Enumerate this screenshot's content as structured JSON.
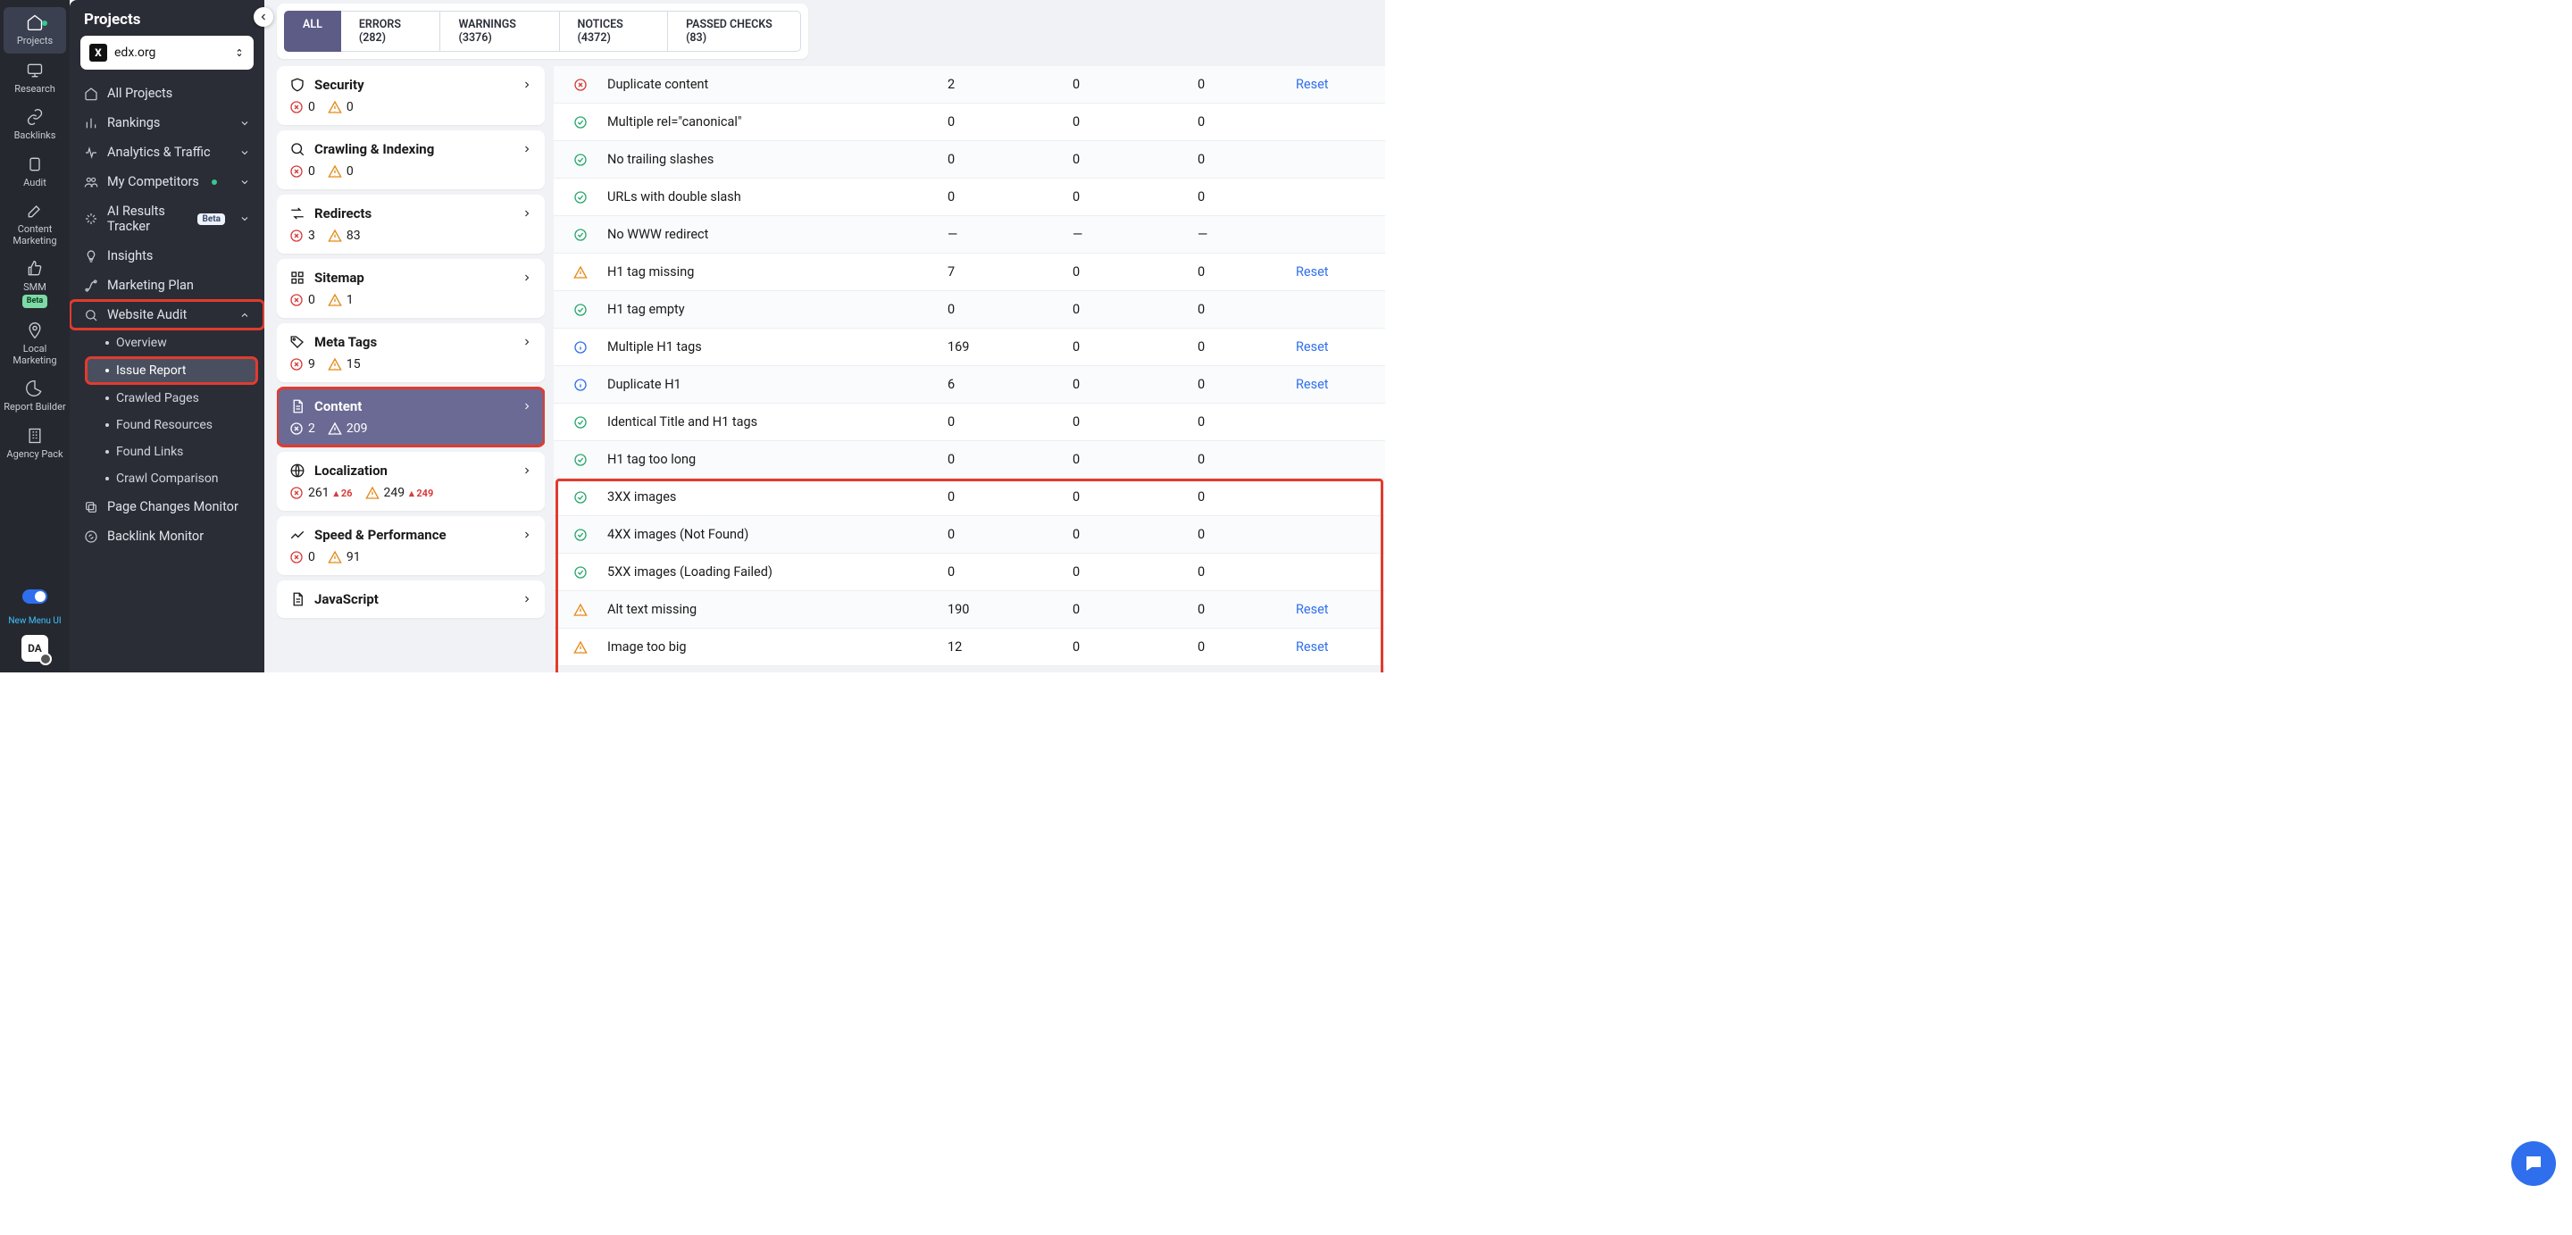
{
  "rail": {
    "items": [
      {
        "label": "Projects",
        "icon": "home"
      },
      {
        "label": "Research",
        "icon": "monitor"
      },
      {
        "label": "Backlinks",
        "icon": "link"
      },
      {
        "label": "Audit",
        "icon": "clipboard"
      },
      {
        "label": "Content Marketing",
        "icon": "edit"
      },
      {
        "label": "SMM",
        "icon": "thumbsup"
      },
      {
        "label": "Local Marketing",
        "icon": "pin"
      },
      {
        "label": "Report Builder",
        "icon": "pie"
      },
      {
        "label": "Agency Pack",
        "icon": "building"
      }
    ],
    "beta_label": "Beta",
    "new_menu": "New Menu UI",
    "da": "DA"
  },
  "sidebar": {
    "title": "Projects",
    "project": "edx.org",
    "items": [
      {
        "label": "All Projects",
        "icon": "home",
        "chev": false
      },
      {
        "label": "Rankings",
        "icon": "bars",
        "chev": true
      },
      {
        "label": "Analytics & Traffic",
        "icon": "pulse",
        "chev": true
      },
      {
        "label": "My Competitors",
        "icon": "users",
        "chev": true,
        "dot": true
      },
      {
        "label": "AI Results Tracker",
        "icon": "sparkle",
        "chev": true,
        "beta": true
      },
      {
        "label": "Insights",
        "icon": "bulb",
        "chev": false
      },
      {
        "label": "Marketing Plan",
        "icon": "route",
        "chev": false
      },
      {
        "label": "Website Audit",
        "icon": "search",
        "chev": true,
        "expanded": true
      },
      {
        "label": "Page Changes Monitor",
        "icon": "copy",
        "chev": false
      },
      {
        "label": "Backlink Monitor",
        "icon": "linkcircle",
        "chev": false
      }
    ],
    "audit_sub": [
      {
        "label": "Overview"
      },
      {
        "label": "Issue Report",
        "active": true
      },
      {
        "label": "Crawled Pages"
      },
      {
        "label": "Found Resources"
      },
      {
        "label": "Found Links"
      },
      {
        "label": "Crawl Comparison"
      }
    ],
    "beta_pill": "Beta"
  },
  "tabs": [
    {
      "label": "ALL",
      "active": true
    },
    {
      "label": "ERRORS (282)"
    },
    {
      "label": "WARNINGS (3376)"
    },
    {
      "label": "NOTICES (4372)"
    },
    {
      "label": "PASSED CHECKS (83)"
    }
  ],
  "categories": [
    {
      "name": "Security",
      "icon": "shield",
      "err": "0",
      "warn": "0"
    },
    {
      "name": "Crawling & Indexing",
      "icon": "search",
      "err": "0",
      "warn": "0"
    },
    {
      "name": "Redirects",
      "icon": "redirect",
      "err": "3",
      "warn": "83"
    },
    {
      "name": "Sitemap",
      "icon": "grid",
      "err": "0",
      "warn": "1"
    },
    {
      "name": "Meta Tags",
      "icon": "tag",
      "err": "9",
      "warn": "15"
    },
    {
      "name": "Content",
      "icon": "doc",
      "err": "2",
      "warn": "209",
      "active": true
    },
    {
      "name": "Localization",
      "icon": "globe",
      "err": "261",
      "warn": "249",
      "errDelta": "26",
      "warnDelta": "249"
    },
    {
      "name": "Speed & Performance",
      "icon": "trend",
      "err": "0",
      "warn": "91"
    },
    {
      "name": "JavaScript",
      "icon": "js",
      "partial": true
    }
  ],
  "issues": [
    {
      "icon": "err",
      "name": "Duplicate content",
      "a": "2",
      "b": "0",
      "c": "0",
      "reset": true
    },
    {
      "icon": "pass",
      "name": "Multiple rel=\"canonical\"",
      "a": "0",
      "b": "0",
      "c": "0"
    },
    {
      "icon": "pass",
      "name": "No trailing slashes",
      "a": "0",
      "b": "0",
      "c": "0"
    },
    {
      "icon": "pass",
      "name": "URLs with double slash",
      "a": "0",
      "b": "0",
      "c": "0"
    },
    {
      "icon": "pass",
      "name": "No WWW redirect",
      "a": "—",
      "b": "—",
      "c": "—"
    },
    {
      "icon": "warn",
      "name": "H1 tag missing",
      "a": "7",
      "b": "0",
      "c": "0",
      "reset": true
    },
    {
      "icon": "pass",
      "name": "H1 tag empty",
      "a": "0",
      "b": "0",
      "c": "0"
    },
    {
      "icon": "info",
      "name": "Multiple H1 tags",
      "a": "169",
      "b": "0",
      "c": "0",
      "reset": true
    },
    {
      "icon": "info",
      "name": "Duplicate H1",
      "a": "6",
      "b": "0",
      "c": "0",
      "reset": true
    },
    {
      "icon": "pass",
      "name": "Identical Title and H1 tags",
      "a": "0",
      "b": "0",
      "c": "0"
    },
    {
      "icon": "pass",
      "name": "H1 tag too long",
      "a": "0",
      "b": "0",
      "c": "0"
    },
    {
      "icon": "pass",
      "name": "3XX images",
      "a": "0",
      "b": "0",
      "c": "0"
    },
    {
      "icon": "pass",
      "name": "4XX images (Not Found)",
      "a": "0",
      "b": "0",
      "c": "0"
    },
    {
      "icon": "pass",
      "name": "5XX images (Loading Failed)",
      "a": "0",
      "b": "0",
      "c": "0"
    },
    {
      "icon": "warn",
      "name": "Alt text missing",
      "a": "190",
      "b": "0",
      "c": "0",
      "reset": true
    },
    {
      "icon": "warn",
      "name": "Image too big",
      "a": "12",
      "b": "0",
      "c": "0",
      "reset": true
    }
  ],
  "reset_label": "Reset"
}
